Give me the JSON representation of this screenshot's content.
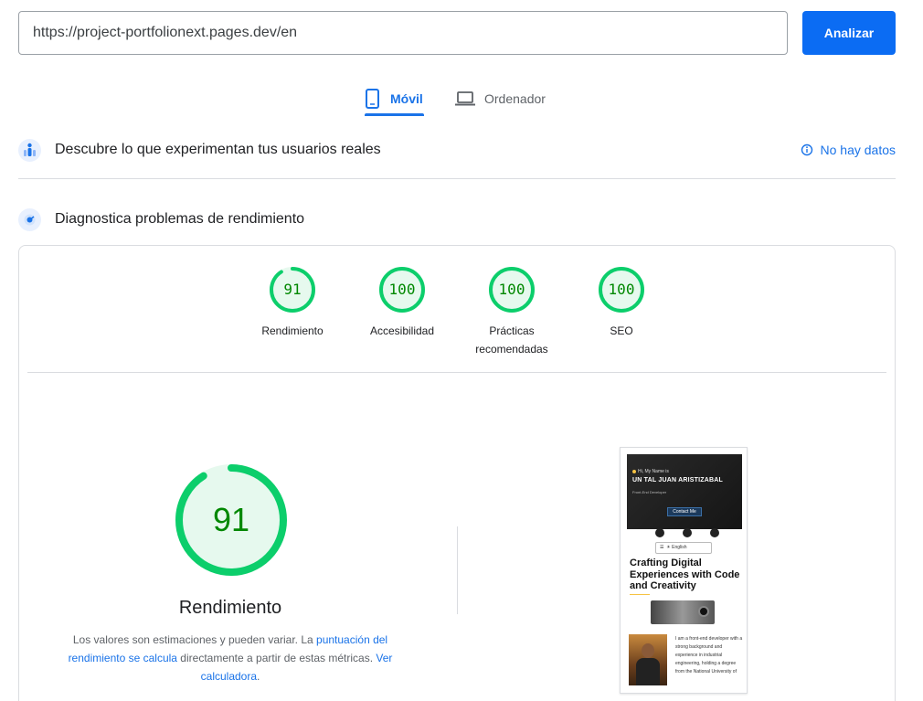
{
  "search": {
    "url_value": "https://project-portfolionext.pages.dev/en",
    "analyze_label": "Analizar"
  },
  "tabs": [
    {
      "label": "Móvil",
      "active": true,
      "icon": "smartphone-icon"
    },
    {
      "label": "Ordenador",
      "active": false,
      "icon": "laptop-icon"
    }
  ],
  "field_data": {
    "title": "Descubre lo que experimentan tus usuarios reales",
    "no_data_label": "No hay datos",
    "icon": "users-icon"
  },
  "lab_data": {
    "title": "Diagnostica problemas de rendimiento",
    "icon": "gauge-icon"
  },
  "scores": [
    {
      "label": "Rendimiento",
      "value": 91
    },
    {
      "label": "Accesibilidad",
      "value": 100
    },
    {
      "label": "Prácticas recomendadas",
      "value": 100
    },
    {
      "label": "SEO",
      "value": 100
    }
  ],
  "performance": {
    "score": 91,
    "label": "Rendimiento",
    "desc_prefix": "Los valores son estimaciones y pueden variar. La ",
    "desc_link1": "puntuación del rendimiento se calcula",
    "desc_middle": " directamente a partir de estas métricas. ",
    "desc_link2": "Ver calculadora",
    "desc_suffix": "."
  },
  "preview": {
    "greeting": "Hi, My Name is",
    "name": "UN TAL JUAN ARISTIZABAL",
    "role": "Front-End Developer",
    "contact": "Contact Me",
    "lang": "English",
    "headline": "Crafting Digital Experiences with Code and Creativity",
    "bio": "I am a front-end developer with a strong background and experience in industrial engineering, holding a degree from the National University of"
  },
  "colors": {
    "accent": "#1a73e8",
    "pass": "#0cce6b",
    "pass_text": "#008800",
    "pass_fill": "#e6f9ee"
  }
}
